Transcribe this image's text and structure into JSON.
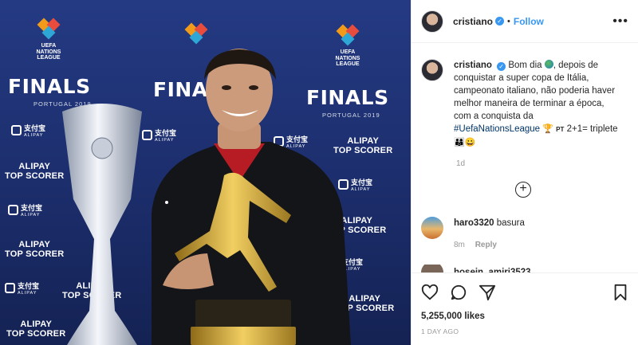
{
  "photo": {
    "finals_text": "FINALS",
    "finals_sub": "PORTUGAL 2019",
    "uefa_lines": [
      "UEFA",
      "NATIONS",
      "LEAGUE"
    ],
    "sponsor_line1": "ALIPAY",
    "sponsor_line2": "TOP SCORER",
    "alipay_cn": "支付宝",
    "alipay_en": "ALIPAY"
  },
  "header": {
    "username": "cristiano",
    "verified_glyph": "✓",
    "separator": "•",
    "follow_label": "Follow",
    "more_glyph": "•••"
  },
  "caption": {
    "username": "cristiano",
    "text_a": "Bom dia",
    "text_b": ", depois de conquistar a super copa de Itália, campeonato italiano, não poderia haver melhor maneira de terminar a época, com a conquista da",
    "hashtag": "#UefaNationsLeague",
    "trophy_emoji": "🏆",
    "pt_text": "PT",
    "score_text": "2+1= triplete",
    "tail_emojis": "👨‍👩‍👦😀",
    "time": "1d"
  },
  "load_more_glyph": "+",
  "comments": [
    {
      "username": "haro3320",
      "text": "basura",
      "time": "8m",
      "reply_label": "Reply"
    },
    {
      "username": "hosein_amiri3523",
      "text": ""
    }
  ],
  "footer": {
    "likes": "5,255,000 likes",
    "ago": "1 DAY AGO"
  },
  "colors": {
    "accent": "#3897f0",
    "text": "#262626",
    "muted": "#999999",
    "border": "#efefef",
    "backdrop": "#1c2d6b"
  }
}
